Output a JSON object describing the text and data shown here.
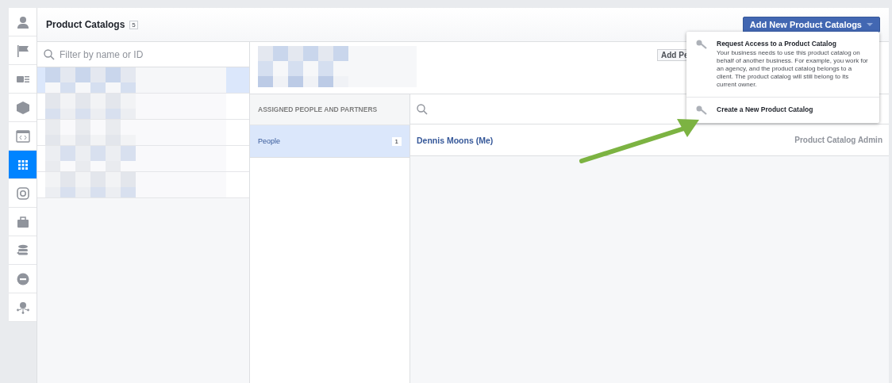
{
  "sidebar": {
    "items": [
      {
        "kind": "person",
        "selected": false
      },
      {
        "kind": "flag",
        "selected": false
      },
      {
        "kind": "card",
        "selected": false
      },
      {
        "kind": "cube",
        "selected": false
      },
      {
        "kind": "code",
        "selected": false
      },
      {
        "kind": "grid",
        "selected": true
      },
      {
        "kind": "camera",
        "selected": false
      },
      {
        "kind": "briefcase",
        "selected": false
      },
      {
        "kind": "sync",
        "selected": false
      },
      {
        "kind": "block",
        "selected": false
      },
      {
        "kind": "network",
        "selected": false
      }
    ]
  },
  "header": {
    "title": "Product Catalogs",
    "count": "5",
    "add_button": "Add New Product Catalogs"
  },
  "catalog_list": {
    "filter_placeholder": "Filter by name or ID",
    "items": [
      {
        "kind": "picture",
        "selected": true
      },
      {
        "kind": "picture",
        "selected": false
      },
      {
        "kind": "picture",
        "selected": false
      },
      {
        "kind": "picture",
        "selected": false
      },
      {
        "kind": "picture",
        "selected": false
      }
    ]
  },
  "detail": {
    "add_button": "Add Pe",
    "sections_heading": "ASSIGNED PEOPLE AND PARTNERS",
    "sections": [
      {
        "label": "People",
        "count": "1",
        "selected": true
      }
    ],
    "people": [
      {
        "name": "Dennis Moons (Me)",
        "role": "Product Catalog Admin"
      }
    ]
  },
  "menu": {
    "items": [
      {
        "title": "Request Access to a Product Catalog",
        "description": "Your business needs to use this product catalog on behalf of another business. For example, you work for an agency, and the product catalog belongs to a client. The product catalog will still belong to its current owner."
      },
      {
        "title": "Create a New Product Catalog"
      }
    ]
  }
}
